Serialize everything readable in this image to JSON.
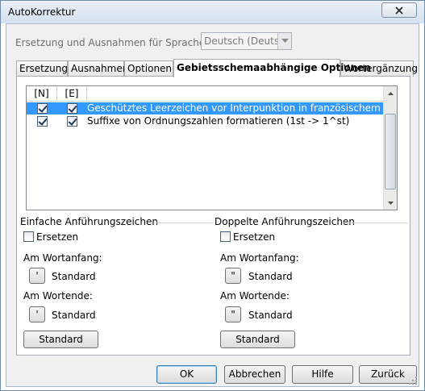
{
  "window": {
    "title": "AutoKorrektur",
    "close_icon": "close-icon"
  },
  "language": {
    "label": "Ersetzung und Ausnahmen für Sprache:",
    "selected": "Deutsch (Deutschland)"
  },
  "tabs": [
    {
      "label": "Ersetzung",
      "active": false
    },
    {
      "label": "Ausnahmen",
      "active": false
    },
    {
      "label": "Optionen",
      "active": false
    },
    {
      "label": "Gebietsschemaabhängige Optionen",
      "active": true
    },
    {
      "label": "Wortergänzung",
      "active": false
    }
  ],
  "options_list": {
    "columns": [
      "[N]",
      "[E]",
      ""
    ],
    "rows": [
      {
        "n": true,
        "e": true,
        "text": "Geschütztes Leerzeichen vor Interpunktion in französischem Text einfügen",
        "selected": true
      },
      {
        "n": true,
        "e": true,
        "text": "Suffixe von Ordnungszahlen formatieren (1st -> 1^st)",
        "selected": false
      }
    ]
  },
  "single_quotes": {
    "title": "Einfache Anführungszeichen",
    "replace_label": "Ersetzen",
    "replace_checked": false,
    "start_label": "Am Wortanfang:",
    "start_char": "'",
    "start_value": "Standard",
    "end_label": "Am Wortende:",
    "end_char": "'",
    "end_value": "Standard",
    "default_button": "Standard"
  },
  "double_quotes": {
    "title": "Doppelte Anführungszeichen",
    "replace_label": "Ersetzen",
    "replace_checked": false,
    "start_label": "Am Wortanfang:",
    "start_char": "\"",
    "start_value": "Standard",
    "end_label": "Am Wortende:",
    "end_char": "\"",
    "end_value": "Standard",
    "default_button": "Standard"
  },
  "buttons": {
    "ok": "OK",
    "cancel": "Abbrechen",
    "help": "Hilfe",
    "back": "Zurück"
  },
  "colors": {
    "selection": "#3399ff",
    "window_border": "#6f8aa8",
    "dialog_bg": "#f0f0f0"
  }
}
